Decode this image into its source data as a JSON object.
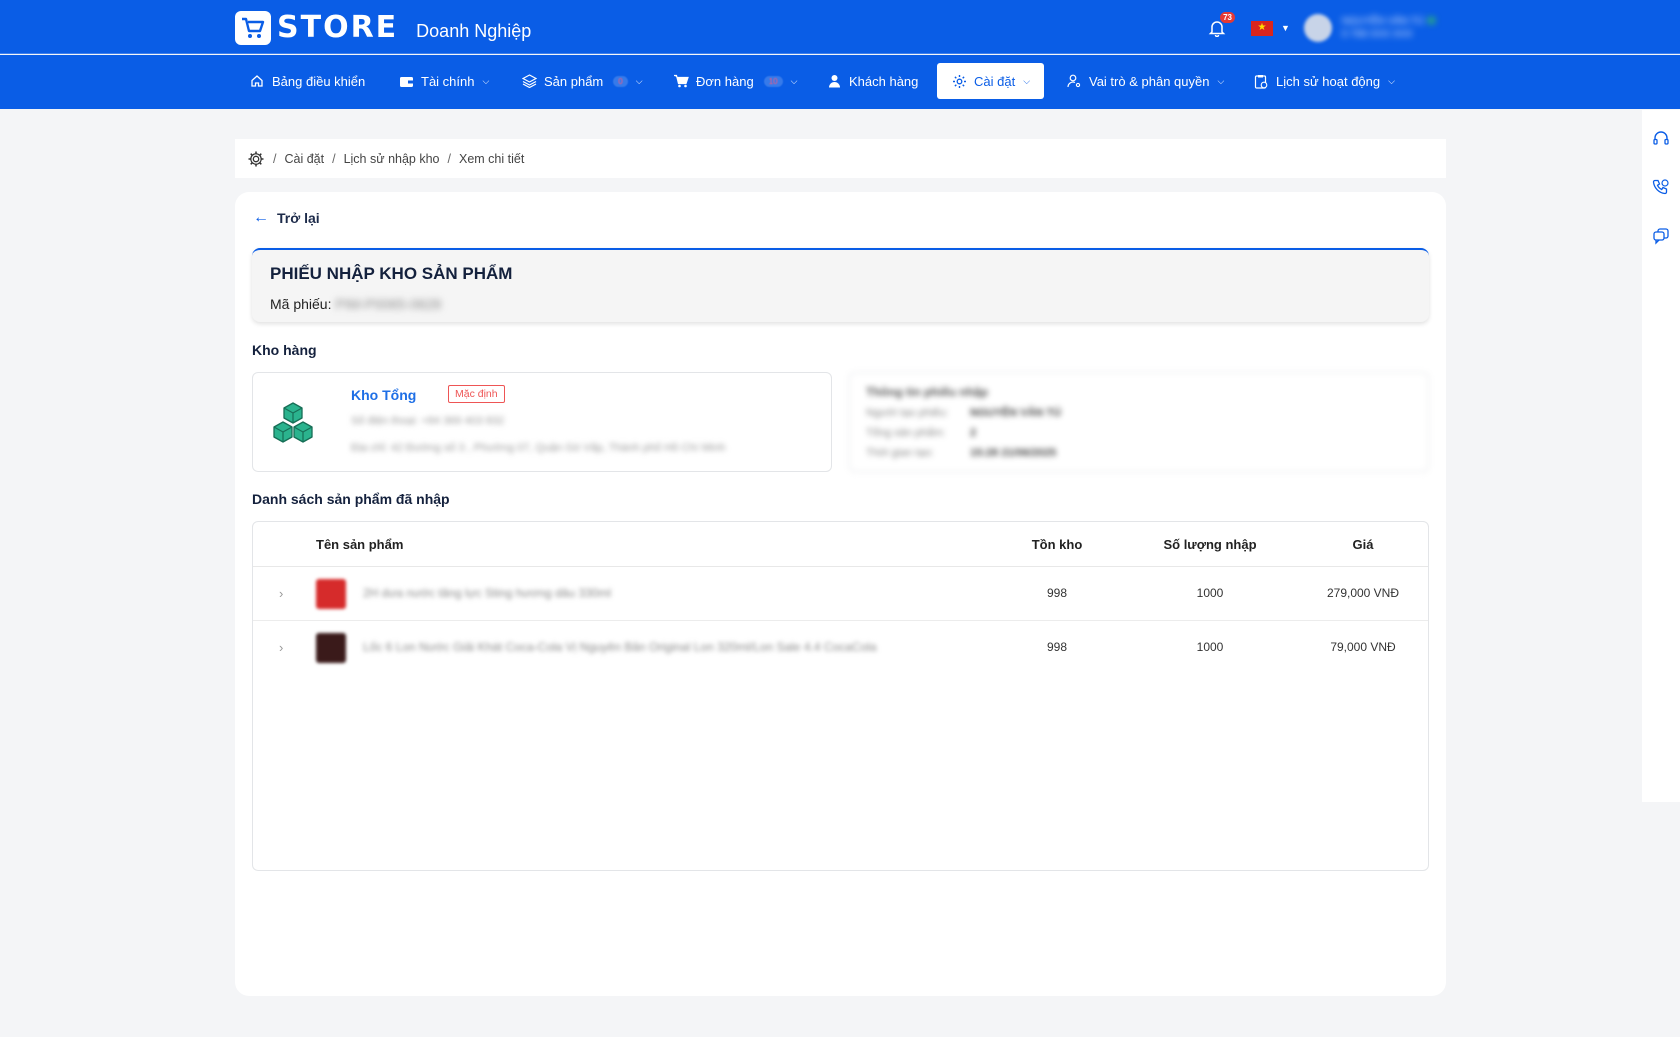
{
  "header": {
    "logo_text": "STORE",
    "subtitle": "Doanh Nghiệp",
    "notification_count": "73",
    "user_name": "NGUYỄN VĂN TÚ",
    "user_phone": "0 769 XXX XXX"
  },
  "nav": {
    "items": [
      {
        "label": "Bảng điều khiển"
      },
      {
        "label": "Tài chính"
      },
      {
        "label": "Sản phẩm",
        "badge": "0"
      },
      {
        "label": "Đơn hàng",
        "badge": "10"
      },
      {
        "label": "Khách hàng"
      },
      {
        "label": "Cài đặt"
      },
      {
        "label": "Vai trò & phân quyền"
      },
      {
        "label": "Lịch sử hoạt động"
      }
    ]
  },
  "breadcrumb": {
    "items": [
      "Cài đặt",
      "Lịch sử nhập kho",
      "Xem chi tiết"
    ]
  },
  "page": {
    "back_label": "Trở lại",
    "receipt_title": "PHIẾU NHẬP KHO SẢN PHẨM",
    "receipt_code_label": "Mã phiếu:",
    "receipt_code_value": "PIM-P0065-0628",
    "warehouse_section": "Kho hàng",
    "warehouse": {
      "name": "Kho Tổng",
      "tag": "Mặc định",
      "phone": "Số điện thoại: +84 369 403 832",
      "address": "Địa chỉ: 42 Đường số 3 , Phường 07, Quận Gò Vấp, Thành phố Hồ Chí Minh"
    },
    "receipt_info": {
      "title": "Thông tin phiếu nhập",
      "creator_label": "Người tạo phiếu:",
      "creator_value": "NGUYỄN VĂN TÚ",
      "total_label": "Tổng sản phẩm:",
      "total_value": "2",
      "time_label": "Thời gian tạo:",
      "time_value": "15:28 21/06/2025"
    },
    "products_section": "Danh sách sản phẩm đã nhập"
  },
  "table": {
    "headers": [
      "Tên sản phẩm",
      "Tồn kho",
      "Số lượng nhập",
      "Giá"
    ],
    "rows": [
      {
        "name": "2H dưa nước tăng lực Sting hương dâu 330ml",
        "stock": "998",
        "qty": "1000",
        "price": "279,000 VNĐ",
        "thumb_color": "#d62b2b"
      },
      {
        "name": "Lốc 6 Lon Nước Giải Khát Coca-Cola Vị Nguyên Bản Original Lon 320ml/Lon Sale 4.4 CocaCola",
        "stock": "998",
        "qty": "1000",
        "price": "79,000 VNĐ",
        "thumb_color": "#3a1a1a"
      }
    ]
  },
  "colors": {
    "primary": "#0a5de6",
    "warehouse_icon": "#1e9c7c",
    "tag_red": "#e55555"
  }
}
